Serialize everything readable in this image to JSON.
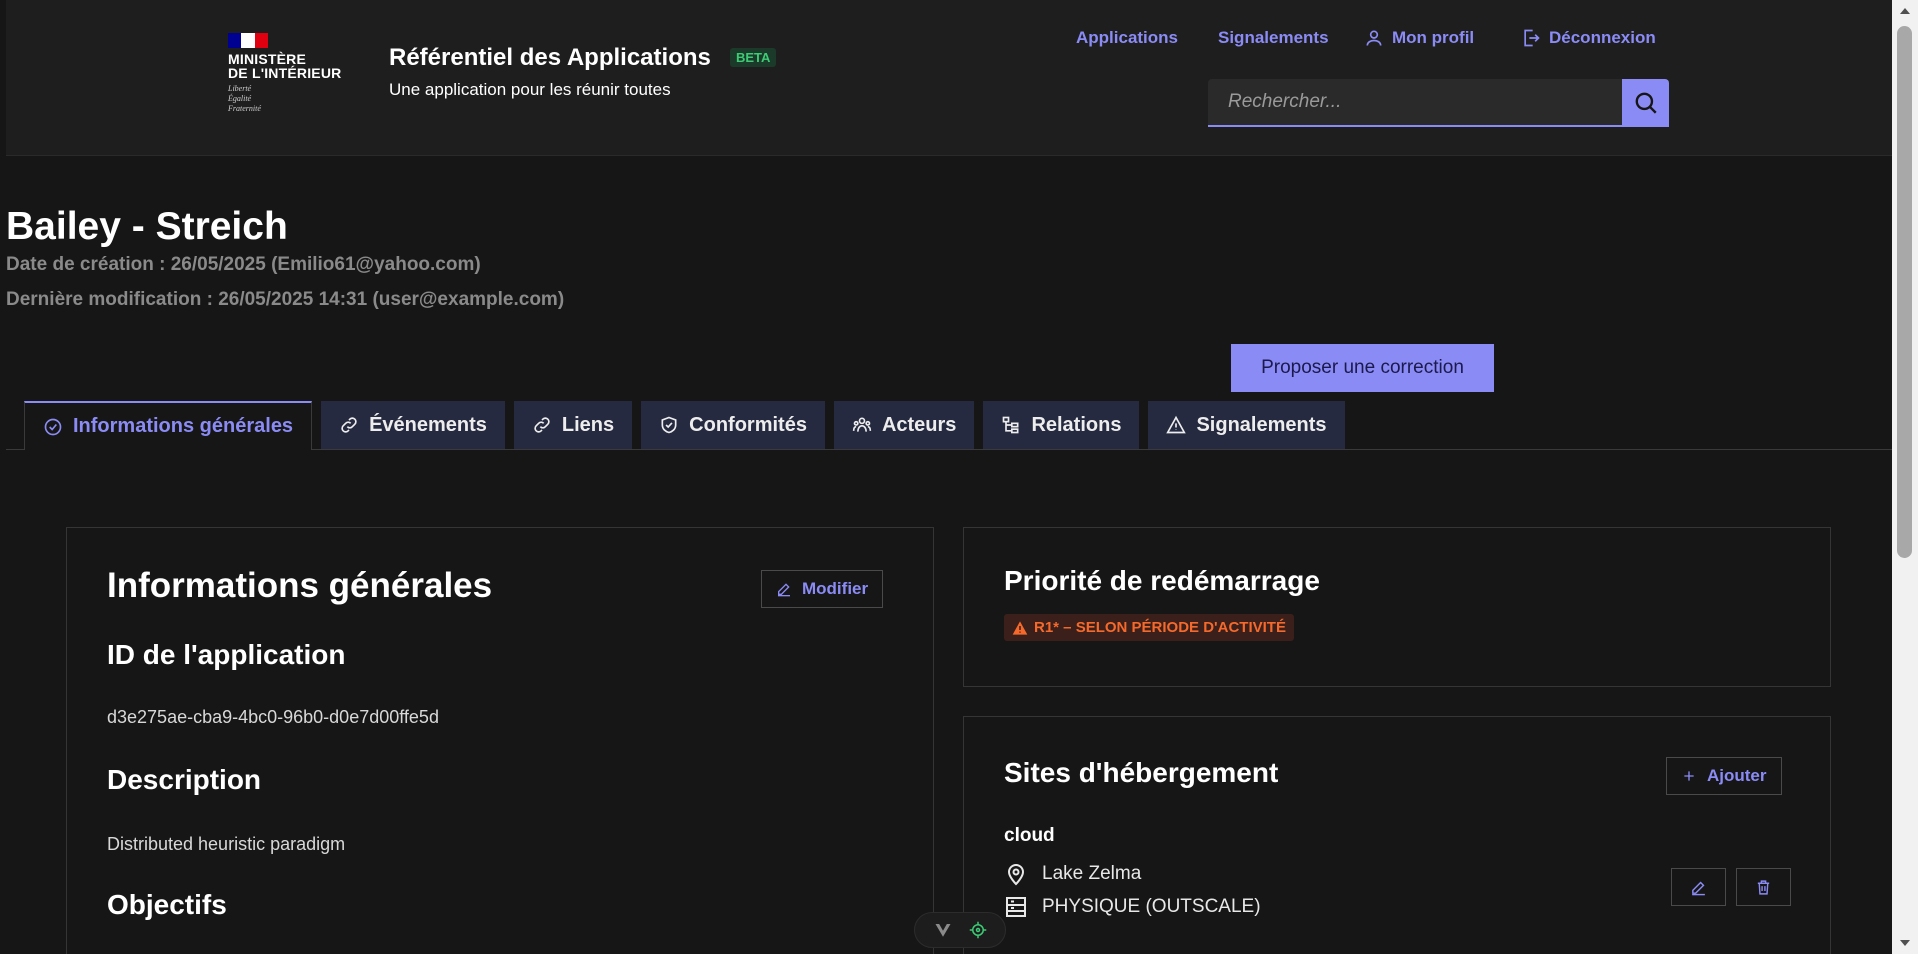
{
  "header": {
    "logo": {
      "ministry_line1": "MINISTÈRE",
      "ministry_line2": "DE L'INTÉRIEUR",
      "motto_1": "Liberté",
      "motto_2": "Égalité",
      "motto_3": "Fraternité"
    },
    "title": "Référentiel des Applications",
    "badge": "BETA",
    "subtitle": "Une application pour les réunir toutes",
    "nav": {
      "applications": "Applications",
      "signalements": "Signalements",
      "profile": "Mon profil",
      "logout": "Déconnexion"
    },
    "search": {
      "placeholder": "Rechercher..."
    }
  },
  "page": {
    "app_name": "Bailey - Streich",
    "created": "Date de création : 26/05/2025 (Emilio61@yahoo.com)",
    "modified": "Dernière modification : 26/05/2025 14:31 (user@example.com)",
    "propose_button": "Proposer une correction"
  },
  "tabs": [
    {
      "label": "Informations générales",
      "icon": "check-circle-icon",
      "active": true
    },
    {
      "label": "Événements",
      "icon": "link-icon"
    },
    {
      "label": "Liens",
      "icon": "link-icon"
    },
    {
      "label": "Conformités",
      "icon": "shield-check-icon"
    },
    {
      "label": "Acteurs",
      "icon": "team-icon"
    },
    {
      "label": "Relations",
      "icon": "hierarchy-icon"
    },
    {
      "label": "Signalements",
      "icon": "warning-icon"
    }
  ],
  "general": {
    "title": "Informations générales",
    "edit_button": "Modifier",
    "id_label": "ID de l'application",
    "id_value": "d3e275ae-cba9-4bc0-96b0-d0e7d00ffe5d",
    "description_label": "Description",
    "description_value": "Distributed heuristic paradigm",
    "objectives_label": "Objectifs"
  },
  "priority": {
    "title": "Priorité de redémarrage",
    "badge": "R1* – Selon période d'activité"
  },
  "hosting": {
    "title": "Sites d'hébergement",
    "add_button": "Ajouter",
    "site_type": "cloud",
    "location": "Lake Zelma",
    "server": "PHYSIQUE (OUTSCALE)"
  },
  "colors": {
    "accent": "#8b8bf6",
    "background": "#161616",
    "header_bg": "#1e1e1e",
    "tab_bg": "#252a40",
    "warning": "#f56a2c",
    "beta": "#3dcb75"
  }
}
